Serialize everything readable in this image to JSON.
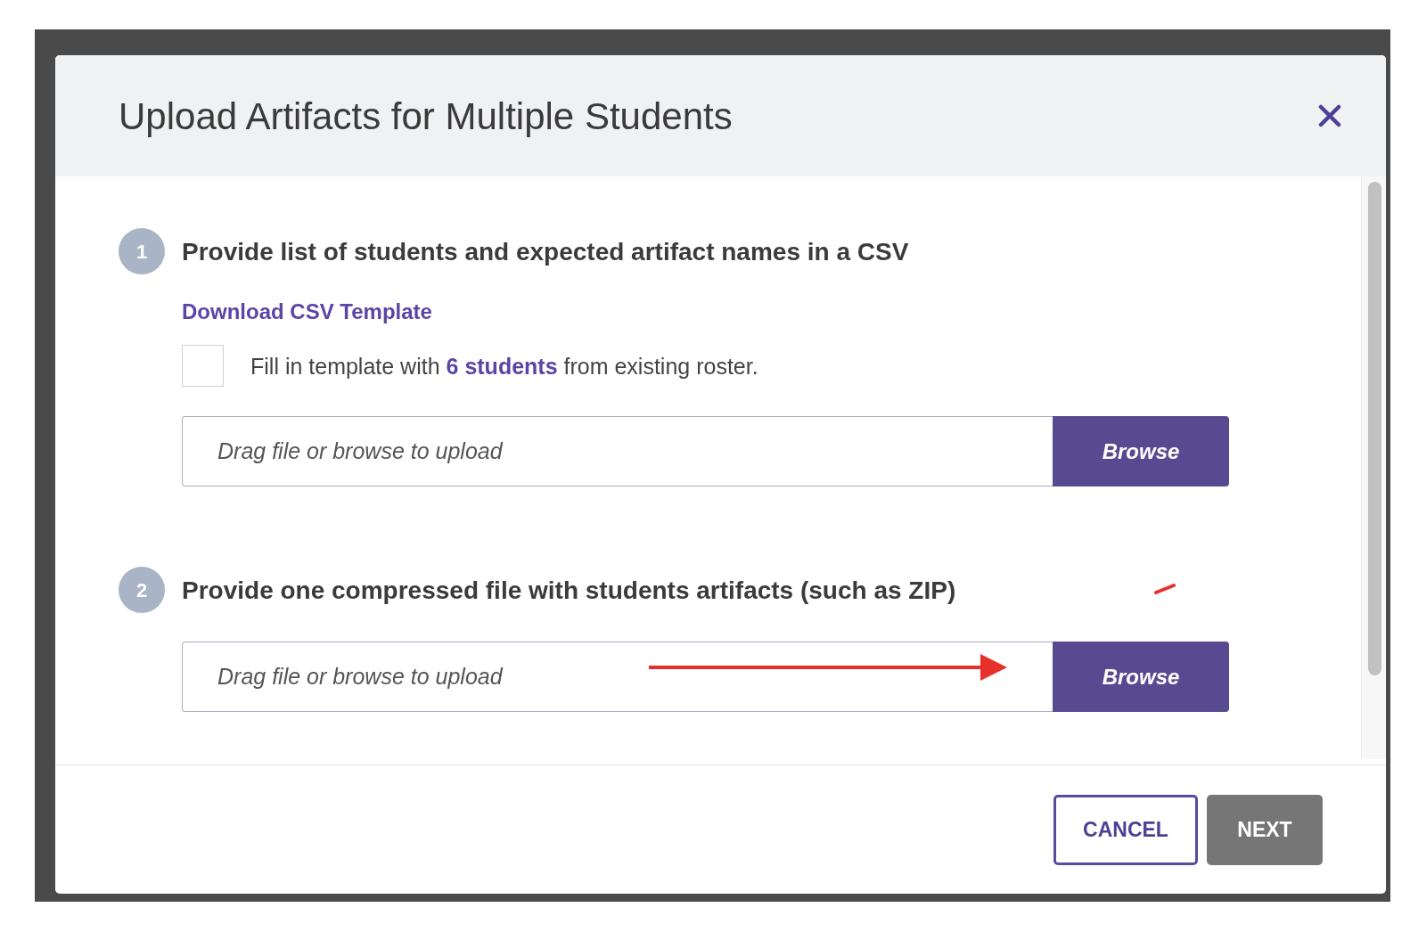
{
  "dialog": {
    "title": "Upload Artifacts for Multiple Students",
    "steps": [
      {
        "number": "1",
        "heading": "Provide list of students and expected artifact names in a CSV",
        "link": "Download CSV Template",
        "checkbox": {
          "label": "Fill in template with **6 students** from existing roster.",
          "checked": false
        },
        "upload": {
          "placeholder": "Drag file or browse to upload",
          "button": "Browse"
        }
      },
      {
        "number": "2",
        "heading": "Provide one compressed file with students artifacts (such as ZIP)",
        "upload": {
          "placeholder": "Drag file or browse to upload",
          "button": "Browse"
        }
      }
    ],
    "buttons": [
      {
        "label": "CANCEL",
        "kind": "outline",
        "disabled": false
      },
      {
        "label": "NEXT",
        "kind": "filled",
        "disabled": true
      }
    ]
  }
}
